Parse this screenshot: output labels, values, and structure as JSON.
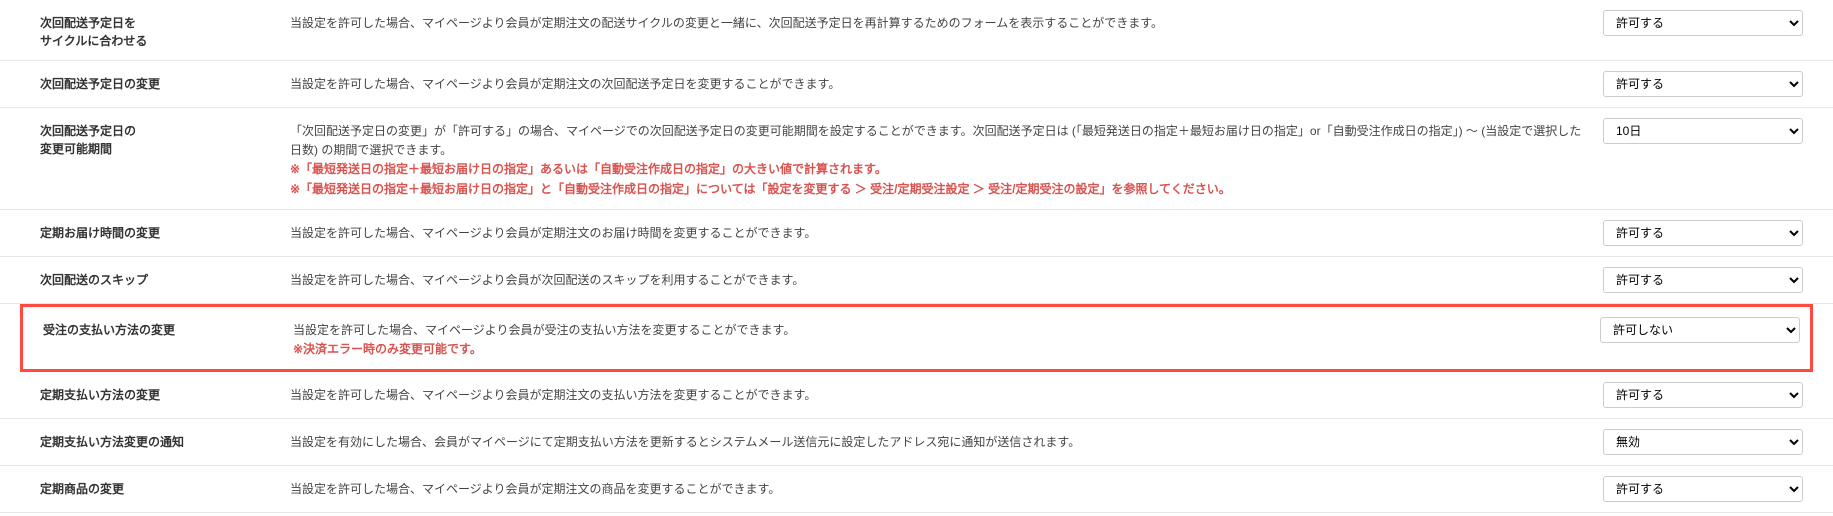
{
  "rows": {
    "r1": {
      "label": "次回配送予定日を\nサイクルに合わせる",
      "desc": "当設定を許可した場合、マイページより会員が定期注文の配送サイクルの変更と一緒に、次回配送予定日を再計算するためのフォームを表示することができます。",
      "value": "許可する"
    },
    "r2": {
      "label": "次回配送予定日の変更",
      "desc": "当設定を許可した場合、マイページより会員が定期注文の次回配送予定日を変更することができます。",
      "value": "許可する"
    },
    "r3": {
      "label": "次回配送予定日の\n変更可能期間",
      "desc": "「次回配送予定日の変更」が「許可する」の場合、マイページでの次回配送予定日の変更可能期間を設定することができます。次回配送予定日は (「最短発送日の指定＋最短お届け日の指定」or「自動受注作成日の指定」) ～ (当設定で選択した日数) の期間で選択できます。",
      "note1": "※「最短発送日の指定＋最短お届け日の指定」あるいは「自動受注作成日の指定」の大きい値で計算されます。",
      "note2": "※「最短発送日の指定＋最短お届け日の指定」と「自動受注作成日の指定」については「設定を変更する ＞ 受注/定期受注設定 ＞ 受注/定期受注の設定」を参照してください。",
      "value": "10日"
    },
    "r4": {
      "label": "定期お届け時間の変更",
      "desc": "当設定を許可した場合、マイページより会員が定期注文のお届け時間を変更することができます。",
      "value": "許可する"
    },
    "r5": {
      "label": "次回配送のスキップ",
      "desc": "当設定を許可した場合、マイページより会員が次回配送のスキップを利用することができます。",
      "value": "許可する"
    },
    "r6": {
      "label": "受注の支払い方法の変更",
      "desc": "当設定を許可した場合、マイページより会員が受注の支払い方法を変更することができます。",
      "note": "※決済エラー時のみ変更可能です。",
      "value": "許可しない"
    },
    "r7": {
      "label": "定期支払い方法の変更",
      "desc": "当設定を許可した場合、マイページより会員が定期注文の支払い方法を変更することができます。",
      "value": "許可する"
    },
    "r8": {
      "label": "定期支払い方法変更の通知",
      "desc": "当設定を有効にした場合、会員がマイページにて定期支払い方法を更新するとシステムメール送信元に設定したアドレス宛に通知が送信されます。",
      "value": "無効"
    },
    "r9": {
      "label": "定期商品の変更",
      "desc": "当設定を許可した場合、マイページより会員が定期注文の商品を変更することができます。",
      "value": "許可する"
    }
  }
}
